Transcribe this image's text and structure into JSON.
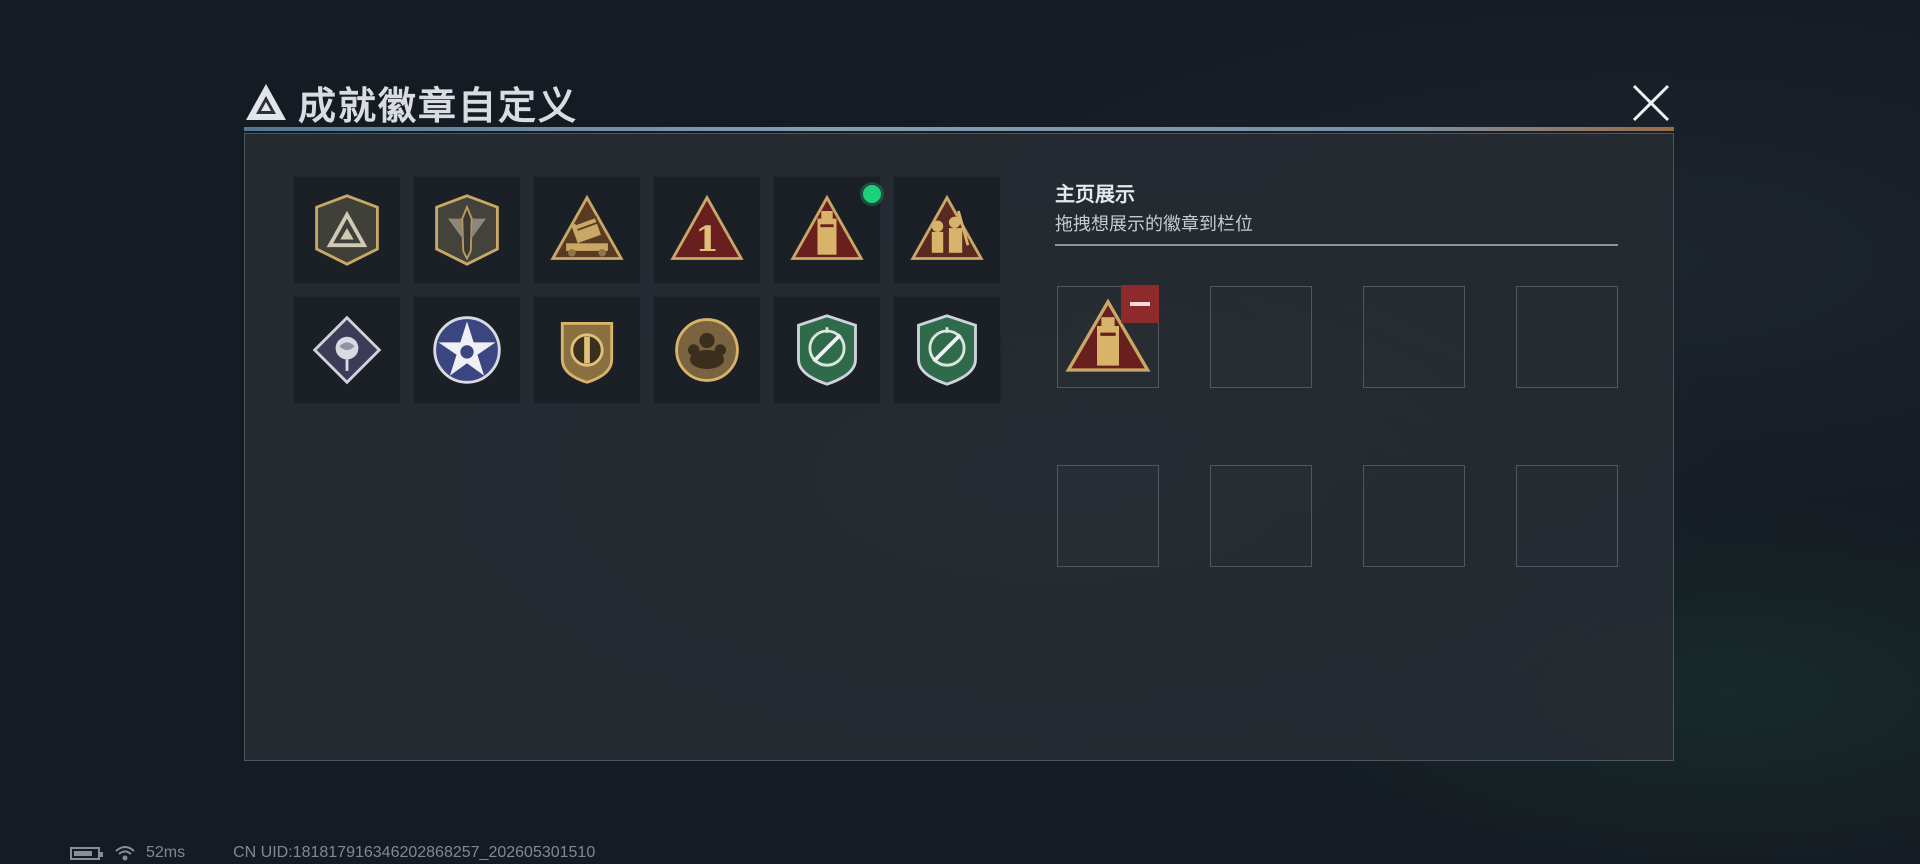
{
  "header": {
    "title": "成就徽章自定义",
    "logo_icon": "triangle-logo-icon",
    "close_icon": "close-icon"
  },
  "badges": [
    {
      "icon": "shield-triangle-badge-icon"
    },
    {
      "icon": "shield-dagger-badge-icon"
    },
    {
      "icon": "triangle-launcher-badge-icon"
    },
    {
      "icon": "triangle-number-one-badge-icon",
      "number": "1"
    },
    {
      "icon": "triangle-tower-badge-icon",
      "selected": true
    },
    {
      "icon": "triangle-soldiers-badge-icon"
    },
    {
      "icon": "diamond-rose-badge-icon"
    },
    {
      "icon": "star-wheel-badge-icon"
    },
    {
      "icon": "shield-emblem-badge-icon"
    },
    {
      "icon": "round-gear-badge-icon"
    },
    {
      "icon": "green-crosshair-knife-badge-icon"
    },
    {
      "icon": "green-crosshair-knife-badge-icon"
    }
  ],
  "showcase": {
    "title": "主页展示",
    "subtitle": "拖拽想展示的徽章到栏位",
    "slots": [
      {
        "badge": "triangle-tower-badge-icon",
        "remove_icon": "minus-icon"
      },
      {
        "badge": ""
      },
      {
        "badge": ""
      },
      {
        "badge": ""
      },
      {
        "badge": ""
      },
      {
        "badge": ""
      },
      {
        "badge": ""
      },
      {
        "badge": ""
      }
    ]
  },
  "status": {
    "ping": "52ms",
    "uid": "CN UID:181817916346202868257_202605301510",
    "battery_icon": "battery-icon",
    "wifi_icon": "wifi-icon"
  },
  "colors": {
    "accent_green": "#1fd07a",
    "remove_red": "#8e2a2b",
    "gold": "#c9a866",
    "dark_red": "#5a1d1d",
    "badge_green": "#2f6a4a"
  }
}
